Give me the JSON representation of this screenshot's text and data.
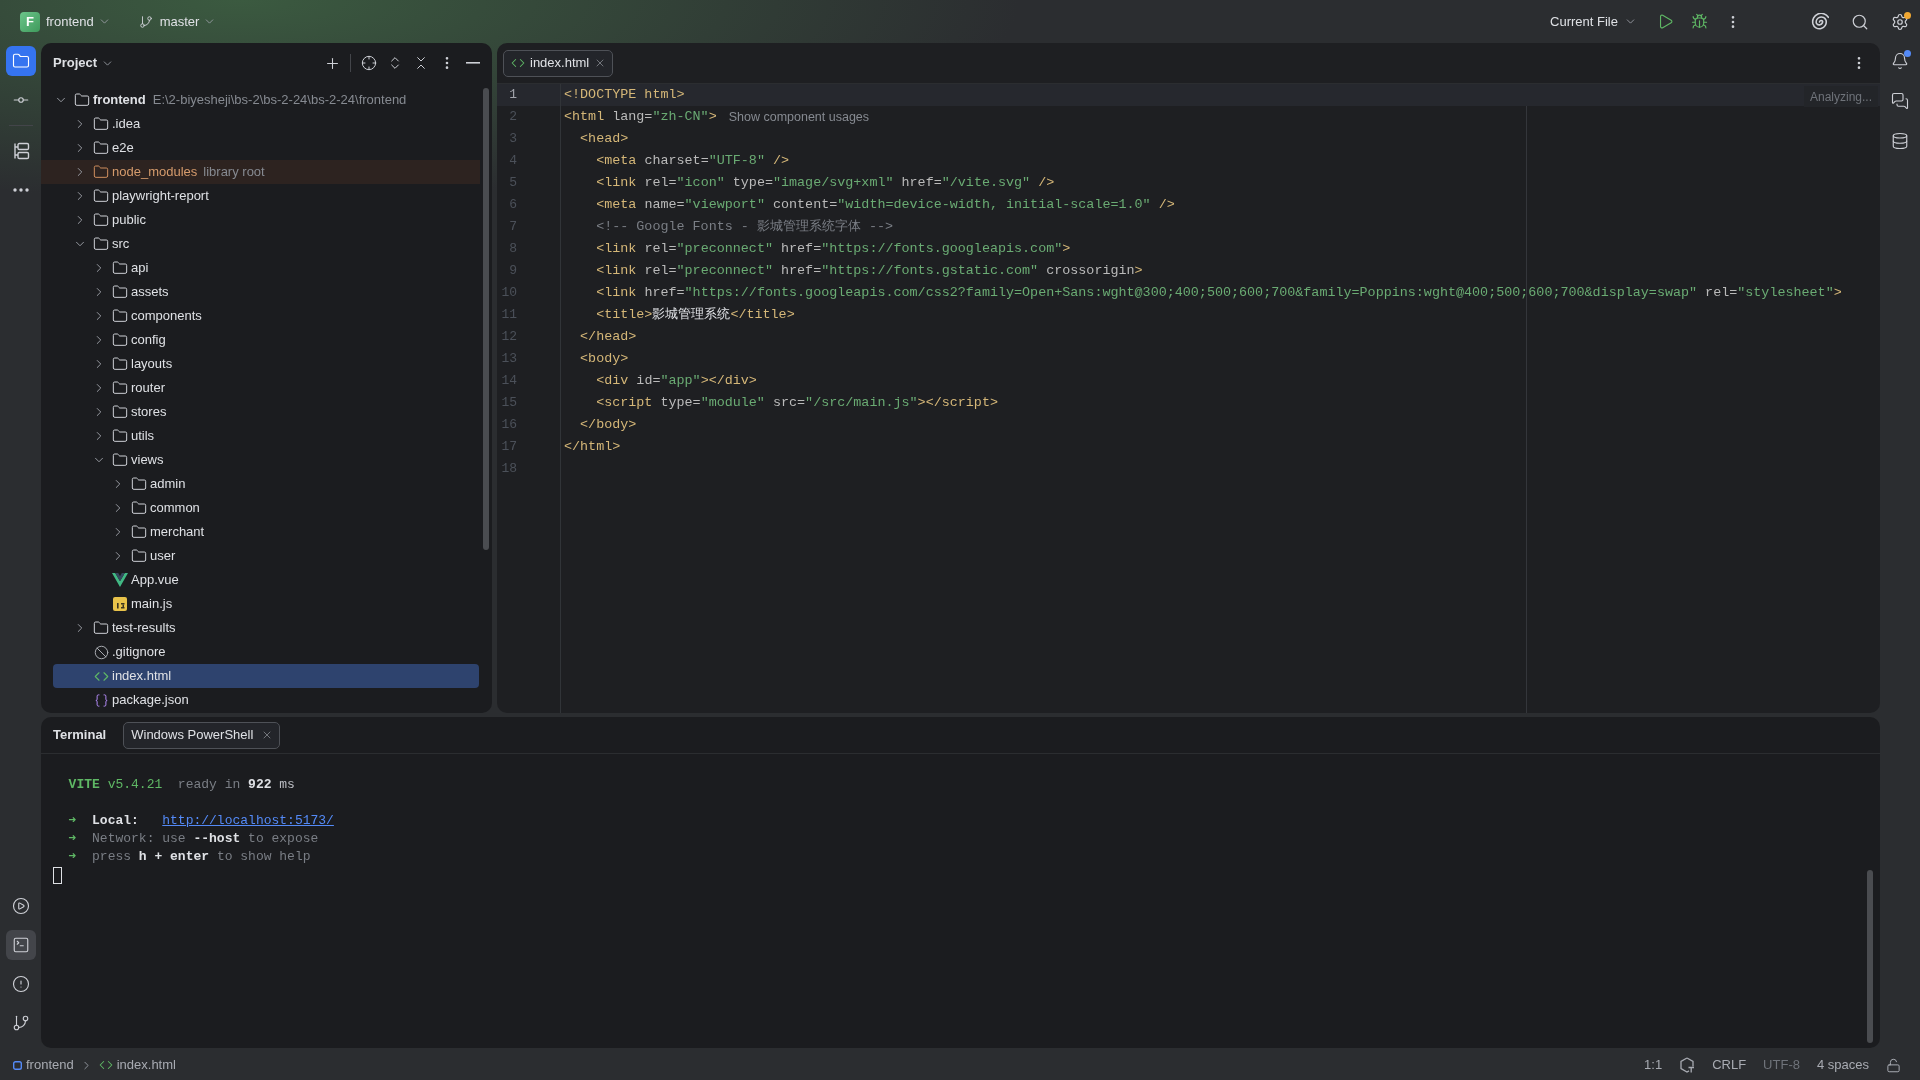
{
  "title_bar": {
    "project": {
      "initial": "F",
      "name": "frontend"
    },
    "branch": "master",
    "run_config": "Current File",
    "settings_badge": true
  },
  "left_strip": {
    "top_groups": [
      {
        "items": [
          {
            "kind": "project",
            "selected": true
          },
          {
            "kind": "commit",
            "selected": false
          }
        ]
      },
      {
        "items": [
          {
            "kind": "structure",
            "selected": false
          },
          {
            "kind": "more",
            "selected": false
          }
        ]
      }
    ],
    "bottom": [
      {
        "kind": "services",
        "selected": false
      },
      {
        "kind": "terminal",
        "selected": true
      },
      {
        "kind": "problems",
        "selected": false
      },
      {
        "kind": "git",
        "selected": false
      }
    ]
  },
  "right_strip": [
    {
      "kind": "notifications",
      "unread": true
    },
    {
      "kind": "ai_chat",
      "unread": false
    },
    {
      "kind": "database",
      "unread": false
    }
  ],
  "project_panel": {
    "title": "Project",
    "tree": [
      {
        "name": "frontend",
        "kind": "folder",
        "path": "E:\\2-biyesheji\\bs-2\\bs-2-24\\bs-2-24\\frontend",
        "expanded": true,
        "selected": false,
        "children": [
          {
            "name": ".idea",
            "kind": "folder",
            "expanded": false,
            "selected": false
          },
          {
            "name": "e2e",
            "kind": "folder",
            "expanded": false,
            "selected": false
          },
          {
            "name": "node_modules",
            "kind": "library",
            "note": "library root",
            "expanded": false,
            "selected": false
          },
          {
            "name": "playwright-report",
            "kind": "folder",
            "expanded": false,
            "selected": false
          },
          {
            "name": "public",
            "kind": "folder",
            "expanded": false,
            "selected": false
          },
          {
            "name": "src",
            "kind": "folder",
            "expanded": true,
            "selected": false,
            "children": [
              {
                "name": "api",
                "kind": "folder",
                "expanded": false,
                "selected": false
              },
              {
                "name": "assets",
                "kind": "folder",
                "expanded": false,
                "selected": false
              },
              {
                "name": "components",
                "kind": "folder",
                "expanded": false,
                "selected": false
              },
              {
                "name": "config",
                "kind": "folder",
                "expanded": false,
                "selected": false
              },
              {
                "name": "layouts",
                "kind": "folder",
                "expanded": false,
                "selected": false
              },
              {
                "name": "router",
                "kind": "folder",
                "expanded": false,
                "selected": false
              },
              {
                "name": "stores",
                "kind": "folder",
                "expanded": false,
                "selected": false
              },
              {
                "name": "utils",
                "kind": "folder",
                "expanded": false,
                "selected": false
              },
              {
                "name": "views",
                "kind": "folder",
                "expanded": true,
                "selected": false,
                "children": [
                  {
                    "name": "admin",
                    "kind": "folder",
                    "expanded": false,
                    "selected": false
                  },
                  {
                    "name": "common",
                    "kind": "folder",
                    "expanded": false,
                    "selected": false
                  },
                  {
                    "name": "merchant",
                    "kind": "folder",
                    "expanded": false,
                    "selected": false
                  },
                  {
                    "name": "user",
                    "kind": "folder",
                    "expanded": false,
                    "selected": false
                  }
                ]
              },
              {
                "name": "App.vue",
                "kind": "vue",
                "selected": false
              },
              {
                "name": "main.js",
                "kind": "js",
                "selected": false
              }
            ]
          },
          {
            "name": "test-results",
            "kind": "folder",
            "expanded": false,
            "selected": false
          },
          {
            "name": ".gitignore",
            "kind": "ignore",
            "selected": false
          },
          {
            "name": "index.html",
            "kind": "html",
            "selected": true
          },
          {
            "name": "package.json",
            "kind": "json",
            "selected": false
          }
        ]
      }
    ]
  },
  "editor": {
    "tabs": [
      {
        "label": "index.html",
        "selected": true
      }
    ],
    "status": "Analyzing...",
    "lines": [
      {
        "number": "1",
        "current": true,
        "tokens": [
          {
            "kind": "tag",
            "text": "<!DOCTYPE html>"
          }
        ]
      },
      {
        "number": "2",
        "current": false,
        "hint": "Show component usages",
        "tokens": [
          {
            "kind": "tag",
            "text": "<html"
          },
          {
            "kind": "attr",
            "text": " lang="
          },
          {
            "kind": "value",
            "text": "\"zh-CN\""
          },
          {
            "kind": "tag",
            "text": ">"
          }
        ]
      },
      {
        "number": "3",
        "current": false,
        "tokens": [
          {
            "kind": "tag",
            "text": "  <head>"
          }
        ]
      },
      {
        "number": "4",
        "current": false,
        "tokens": [
          {
            "kind": "tag",
            "text": "    <meta"
          },
          {
            "kind": "attr",
            "text": " charset="
          },
          {
            "kind": "value",
            "text": "\"UTF-8\""
          },
          {
            "kind": "tag",
            "text": " />"
          }
        ]
      },
      {
        "number": "5",
        "current": false,
        "tokens": [
          {
            "kind": "tag",
            "text": "    <link"
          },
          {
            "kind": "attr",
            "text": " rel="
          },
          {
            "kind": "value",
            "text": "\"icon\""
          },
          {
            "kind": "attr",
            "text": " type="
          },
          {
            "kind": "value",
            "text": "\"image/svg+xml\""
          },
          {
            "kind": "attr",
            "text": " href="
          },
          {
            "kind": "value",
            "text": "\"/vite.svg\""
          },
          {
            "kind": "tag",
            "text": " />"
          }
        ]
      },
      {
        "number": "6",
        "current": false,
        "tokens": [
          {
            "kind": "tag",
            "text": "    <meta"
          },
          {
            "kind": "attr",
            "text": " name="
          },
          {
            "kind": "value",
            "text": "\"viewport\""
          },
          {
            "kind": "attr",
            "text": " content="
          },
          {
            "kind": "value",
            "text": "\"width=device-width, initial-scale=1.0\""
          },
          {
            "kind": "tag",
            "text": " />"
          }
        ]
      },
      {
        "number": "7",
        "current": false,
        "tokens": [
          {
            "kind": "comment",
            "text": "    <!-- Google Fonts - 影城管理系统字体 -->"
          }
        ]
      },
      {
        "number": "8",
        "current": false,
        "tokens": [
          {
            "kind": "tag",
            "text": "    <link"
          },
          {
            "kind": "attr",
            "text": " rel="
          },
          {
            "kind": "value",
            "text": "\"preconnect\""
          },
          {
            "kind": "attr",
            "text": " href="
          },
          {
            "kind": "value",
            "text": "\"https://fonts.googleapis.com\""
          },
          {
            "kind": "tag",
            "text": ">"
          }
        ]
      },
      {
        "number": "9",
        "current": false,
        "tokens": [
          {
            "kind": "tag",
            "text": "    <link"
          },
          {
            "kind": "attr",
            "text": " rel="
          },
          {
            "kind": "value",
            "text": "\"preconnect\""
          },
          {
            "kind": "attr",
            "text": " href="
          },
          {
            "kind": "value",
            "text": "\"https://fonts.gstatic.com\""
          },
          {
            "kind": "attr",
            "text": " crossorigin"
          },
          {
            "kind": "tag",
            "text": ">"
          }
        ]
      },
      {
        "number": "10",
        "current": false,
        "tokens": [
          {
            "kind": "tag",
            "text": "    <link"
          },
          {
            "kind": "attr",
            "text": " href="
          },
          {
            "kind": "value",
            "text": "\"https://fonts.googleapis.com/css2?family=Open+Sans:wght@300;400;500;600;700&family=Poppins:wght@400;500;600;700&display=swap\""
          },
          {
            "kind": "attr",
            "text": " rel="
          },
          {
            "kind": "value",
            "text": "\"stylesheet\""
          },
          {
            "kind": "tag",
            "text": ">"
          }
        ]
      },
      {
        "number": "11",
        "current": false,
        "tokens": [
          {
            "kind": "tag",
            "text": "    <title>"
          },
          {
            "kind": "text",
            "text": "影城管理系统"
          },
          {
            "kind": "tag",
            "text": "</title>"
          }
        ]
      },
      {
        "number": "12",
        "current": false,
        "tokens": [
          {
            "kind": "tag",
            "text": "  </head>"
          }
        ]
      },
      {
        "number": "13",
        "current": false,
        "tokens": [
          {
            "kind": "tag",
            "text": "  <body>"
          }
        ]
      },
      {
        "number": "14",
        "current": false,
        "tokens": [
          {
            "kind": "tag",
            "text": "    <div"
          },
          {
            "kind": "attr",
            "text": " id="
          },
          {
            "kind": "value",
            "text": "\"app\""
          },
          {
            "kind": "tag",
            "text": "></div>"
          }
        ]
      },
      {
        "number": "15",
        "current": false,
        "tokens": [
          {
            "kind": "tag",
            "text": "    <script"
          },
          {
            "kind": "attr",
            "text": " type="
          },
          {
            "kind": "value",
            "text": "\"module\""
          },
          {
            "kind": "attr",
            "text": " src="
          },
          {
            "kind": "value",
            "text": "\"/src/main.js\""
          },
          {
            "kind": "tag",
            "text": "></script>"
          }
        ]
      },
      {
        "number": "16",
        "current": false,
        "tokens": [
          {
            "kind": "tag",
            "text": "  </body>"
          }
        ]
      },
      {
        "number": "17",
        "current": false,
        "tokens": [
          {
            "kind": "tag",
            "text": "</html>"
          }
        ]
      },
      {
        "number": "18",
        "current": false
      }
    ]
  },
  "terminal": {
    "title": "Terminal",
    "tabs": [
      {
        "label": "Windows PowerShell",
        "selected": true
      }
    ],
    "lines": [
      {
        "kind": "banner",
        "tokens": [
          {
            "kind": "brand",
            "text": "  VITE"
          },
          {
            "kind": "green",
            "text": " v5.4.21"
          },
          {
            "kind": "dim",
            "text": "  ready in "
          },
          {
            "kind": "bold",
            "text": "922"
          },
          {
            "kind": "plain",
            "text": " ms"
          }
        ]
      },
      {
        "kind": "line",
        "tokens": [
          {
            "kind": "green",
            "text": "  ➜"
          },
          {
            "kind": "bold",
            "text": "  Local:   "
          },
          {
            "kind": "link",
            "text": "http://localhost:5173/"
          }
        ]
      },
      {
        "kind": "line",
        "tokens": [
          {
            "kind": "green",
            "text": "  ➜"
          },
          {
            "kind": "dim",
            "text": "  Network: use "
          },
          {
            "kind": "bold",
            "text": "--host"
          },
          {
            "kind": "dim",
            "text": " to expose"
          }
        ]
      },
      {
        "kind": "line",
        "tokens": [
          {
            "kind": "green",
            "text": "  ➜"
          },
          {
            "kind": "dim",
            "text": "  press "
          },
          {
            "kind": "bold",
            "text": "h + enter"
          },
          {
            "kind": "dim",
            "text": " to show help"
          }
        ]
      },
      {
        "kind": "cursor"
      }
    ]
  },
  "status_bar": {
    "breadcrumbs": [
      {
        "label": "frontend",
        "kind": "module"
      },
      {
        "label": "index.html",
        "kind": "html"
      }
    ],
    "widgets": [
      {
        "kind": "text",
        "label": "1:1",
        "disabled": false
      },
      {
        "kind": "inspection",
        "disabled": false
      },
      {
        "kind": "text",
        "label": "CRLF",
        "disabled": false
      },
      {
        "kind": "text",
        "label": "UTF-8",
        "disabled": true
      },
      {
        "kind": "text",
        "label": "4 spaces",
        "disabled": false
      },
      {
        "kind": "lock",
        "disabled": false
      }
    ]
  }
}
